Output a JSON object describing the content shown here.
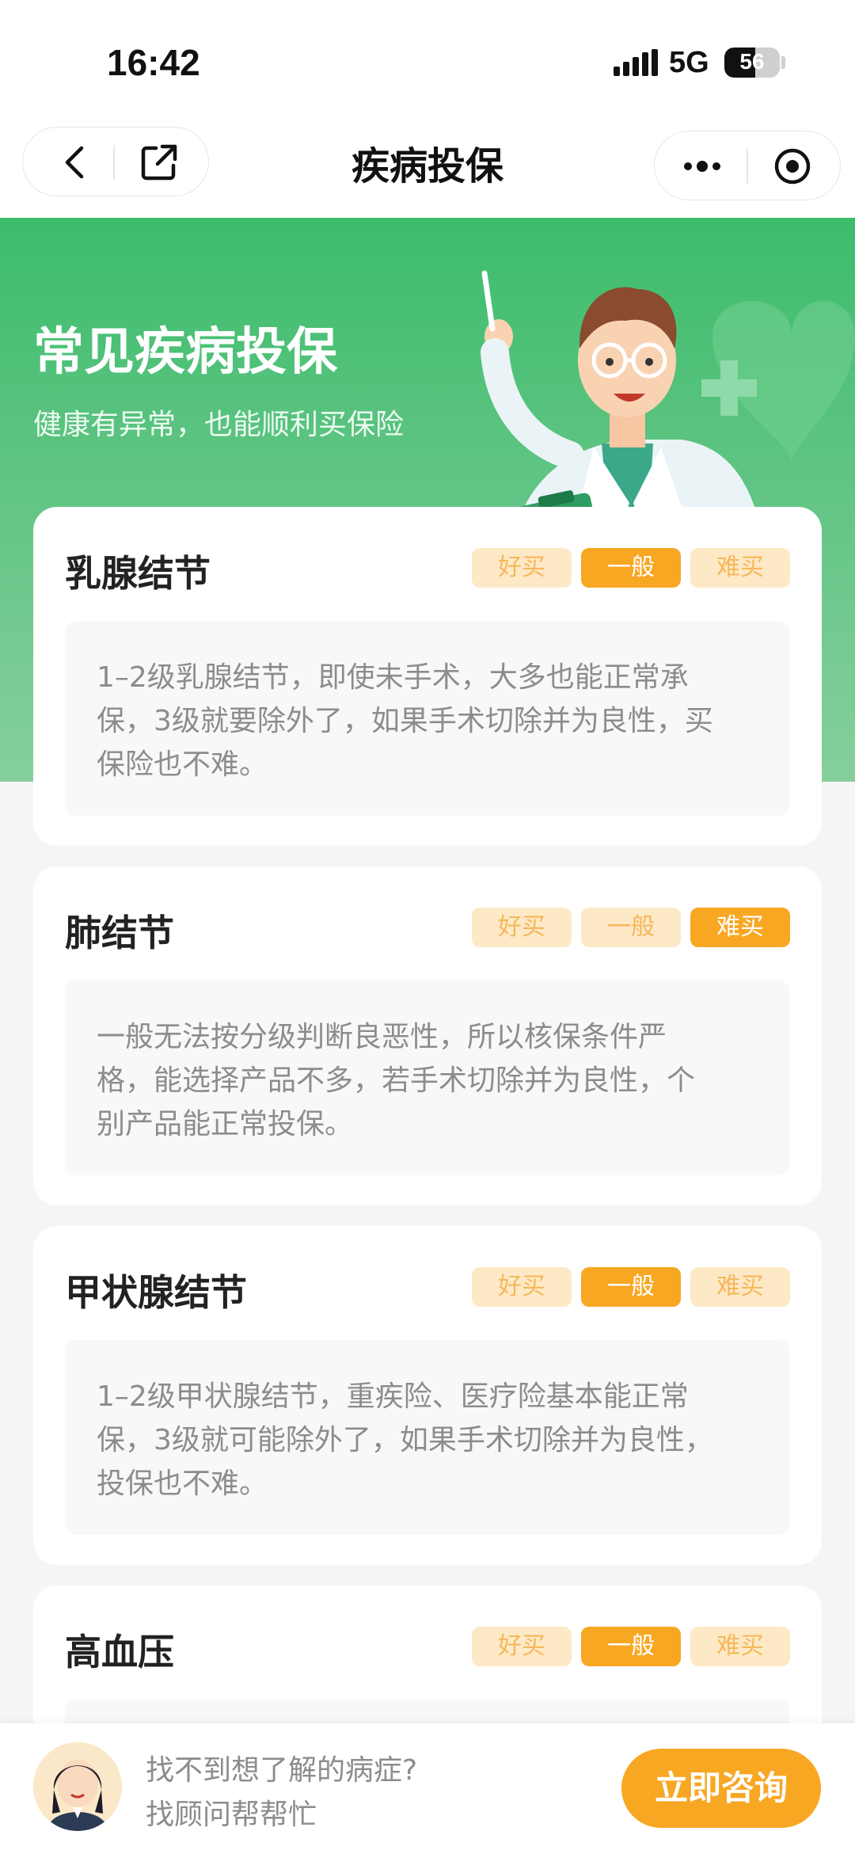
{
  "status_bar": {
    "time": "16:42",
    "network": "5G",
    "battery": "56",
    "battery_level": 0.56
  },
  "nav": {
    "title": "疾病投保"
  },
  "banner": {
    "title": "常见疾病投保",
    "subtitle": "健康有异常，也能顺利买保险"
  },
  "rating_labels": [
    "好买",
    "一般",
    "难买"
  ],
  "diseases": [
    {
      "name": "乳腺结节",
      "selected": "一般",
      "desc": [
        "1–2级乳腺结节，即使未手术，大多也能正常承",
        "保，3级就要除外了，如果手术切除并为良性，买",
        "保险也不难。"
      ]
    },
    {
      "name": "肺结节",
      "selected": "难买",
      "desc": [
        "一般无法按分级判断良恶性，所以核保条件严",
        "格，能选择产品不多，若手术切除并为良性，个",
        "别产品能正常投保。"
      ]
    },
    {
      "name": "甲状腺结节",
      "selected": "一般",
      "desc": [
        "1–2级甲状腺结节，重疾险、医疗险基本能正常",
        "保，3级就可能除外了，如果手术切除并为良性，",
        "投保也不难。"
      ]
    },
    {
      "name": "高血压",
      "selected": "一般",
      "desc": []
    }
  ],
  "bottom_bar": {
    "line1": "找不到想了解的病症?",
    "line2": "找顾问帮帮忙",
    "button": "立即咨询"
  },
  "colors": {
    "green": "#3cbd6b",
    "orange": "#f8a723",
    "tag_off_bg": "#fde9c6",
    "tag_off_text": "#f6b75a"
  },
  "icons": [
    "back-icon",
    "share-icon",
    "more-icon",
    "target-icon",
    "signal-icon",
    "battery-icon"
  ]
}
